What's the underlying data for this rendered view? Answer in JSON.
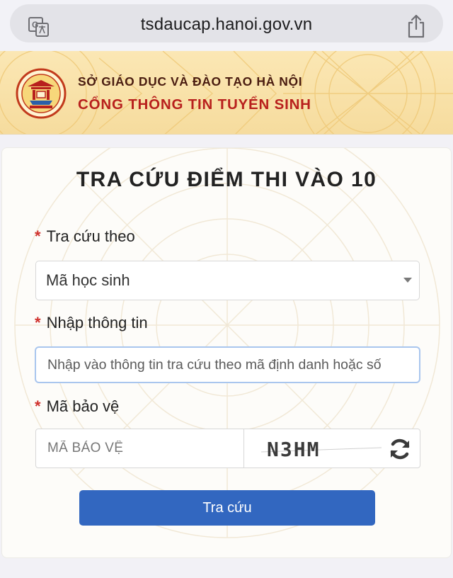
{
  "browser": {
    "url": "tsdaucap.hanoi.gov.vn",
    "translate_icon": "translate-icon",
    "share_icon": "share-icon"
  },
  "header": {
    "department": "SỞ GIÁO DỤC VÀ ĐÀO TẠO HÀ NỘI",
    "portal": "CỔNG THÔNG TIN TUYỂN SINH",
    "logo": "hanoi-education-logo"
  },
  "form": {
    "title": "TRA CỨU ĐIỂM THI VÀO 10",
    "required_mark": "*",
    "lookup_by_label": "Tra cứu theo",
    "lookup_by_value": "Mã học sinh",
    "info_label": "Nhập thông tin",
    "info_placeholder": "Nhập vào thông tin tra cứu theo mã định danh hoặc số",
    "captcha_label": "Mã bảo vệ",
    "captcha_placeholder": "MÃ BẢO VỆ",
    "captcha_text": "N3HM",
    "submit_label": "Tra cứu"
  },
  "colors": {
    "accent": "#3267c0",
    "required": "#d0312d",
    "portal_title": "#b8201d",
    "header_bg": "#f8e0a6"
  }
}
